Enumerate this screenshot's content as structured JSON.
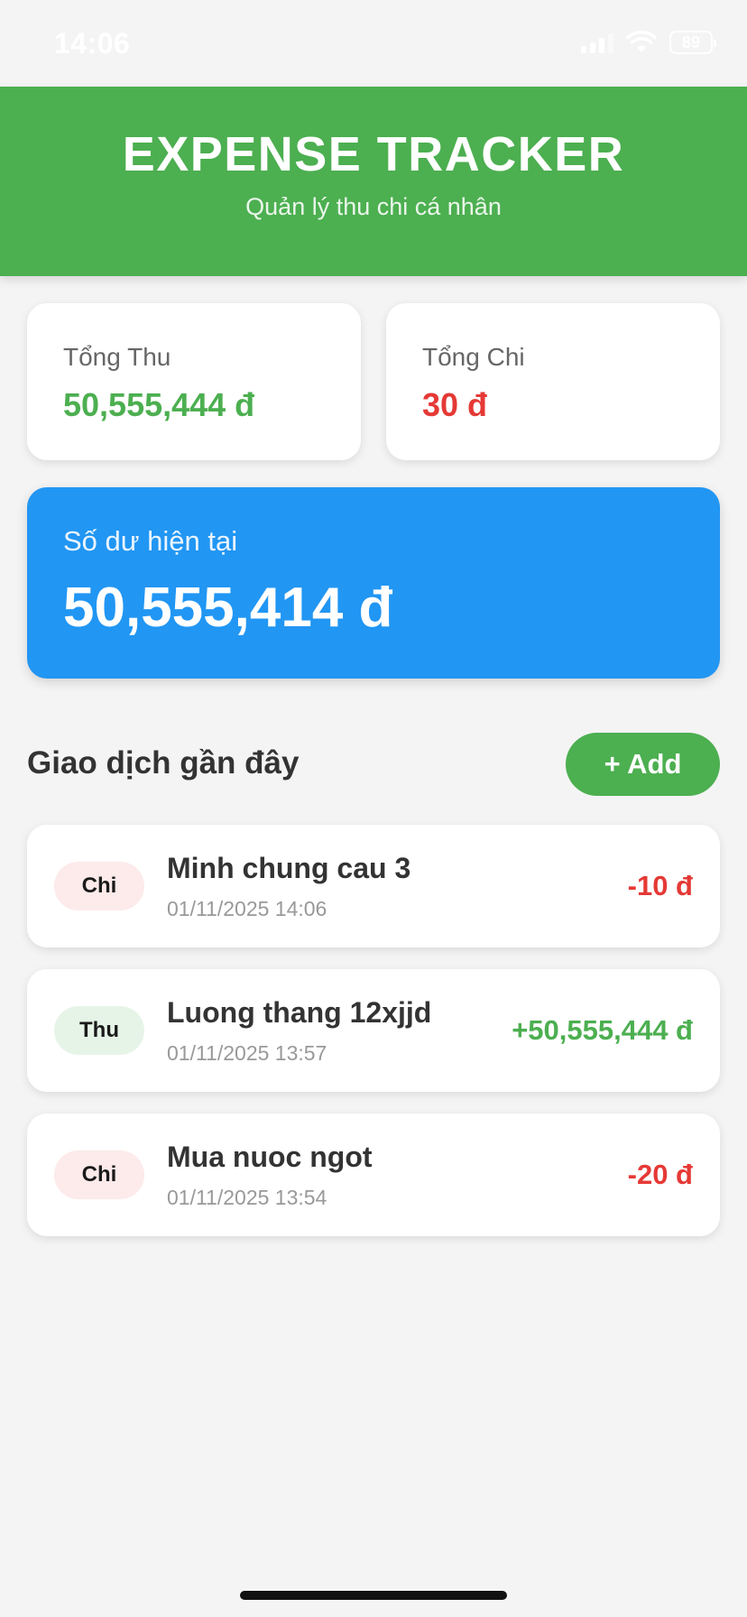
{
  "status_bar": {
    "time": "14:06",
    "battery": "89",
    "icons": [
      "signal-icon",
      "wifi-icon",
      "battery-icon"
    ]
  },
  "header": {
    "title": "EXPENSE TRACKER",
    "subtitle": "Quản lý thu chi cá nhân"
  },
  "summary": {
    "income": {
      "label": "Tổng Thu",
      "value": "50,555,444 đ"
    },
    "expense": {
      "label": "Tổng Chi",
      "value": "30 đ"
    }
  },
  "balance": {
    "label": "Số dư hiện tại",
    "value": "50,555,414 đ"
  },
  "transactions_section": {
    "title": "Giao dịch gần đây",
    "add_label": "+ Add"
  },
  "transactions": [
    {
      "type": "Chi",
      "title": "Minh chung cau 3",
      "date": "01/11/2025 14:06",
      "amount": "-10 đ"
    },
    {
      "type": "Thu",
      "title": "Luong thang 12xjjd",
      "date": "01/11/2025 13:57",
      "amount": "+50,555,444 đ"
    },
    {
      "type": "Chi",
      "title": "Mua nuoc ngot",
      "date": "01/11/2025 13:54",
      "amount": "-20 đ"
    }
  ],
  "colors": {
    "primary_green": "#4caf50",
    "balance_blue": "#2196f3",
    "expense_red": "#e53935",
    "background": "#f4f4f4"
  }
}
